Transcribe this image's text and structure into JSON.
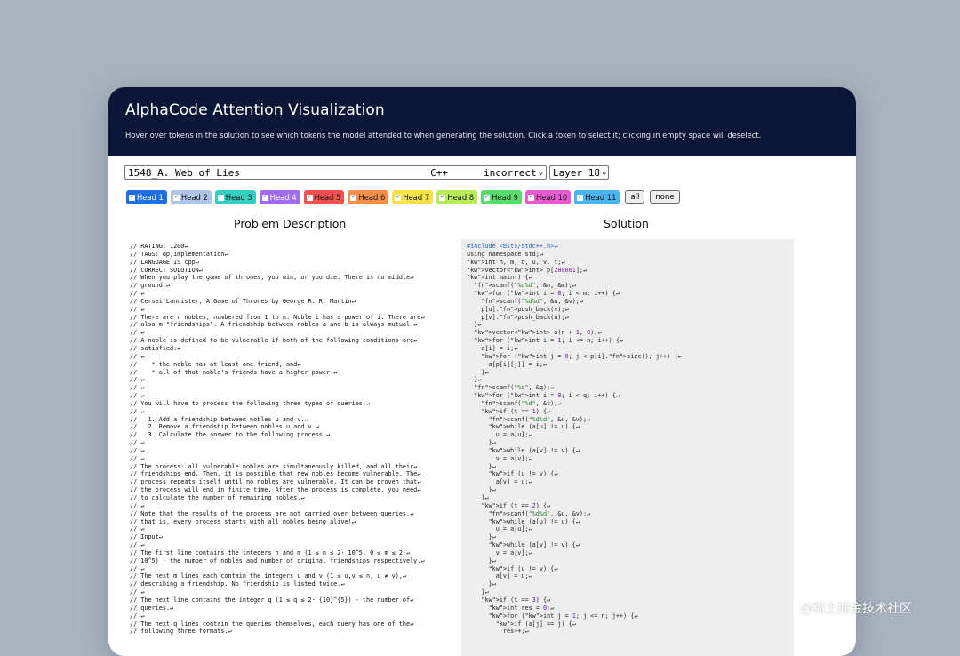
{
  "app": {
    "title": "AlphaCode Attention Visualization",
    "subtitle": "Hover over tokens in the solution to see which tokens the model attended to when generating the solution. Click a token to select it; clicking in empty space will deselect."
  },
  "selectors": {
    "problem_name": "1548_A. Web of Lies",
    "language": "C++",
    "correctness": "incorrect",
    "layer": "Layer 18"
  },
  "heads": [
    {
      "label": "Head 1",
      "color": "#1f6fe0"
    },
    {
      "label": "Head 2",
      "color": "#b0c4e8"
    },
    {
      "label": "Head 3",
      "color": "#34cfc0"
    },
    {
      "label": "Head 4",
      "color": "#a06cf0"
    },
    {
      "label": "Head 5",
      "color": "#f0504e"
    },
    {
      "label": "Head 6",
      "color": "#f7904a"
    },
    {
      "label": "Head 7",
      "color": "#f7e04a"
    },
    {
      "label": "Head 8",
      "color": "#b8ea5a"
    },
    {
      "label": "Head 9",
      "color": "#5adc6a"
    },
    {
      "label": "Head 10",
      "color": "#e85ad0"
    },
    {
      "label": "Head 11",
      "color": "#4ab4f0"
    }
  ],
  "buttons": {
    "all": "all",
    "none": "none"
  },
  "columns": {
    "problem": "Problem Description",
    "solution": "Solution"
  },
  "problem_lines": [
    "// RATING: 1200↵",
    "// TAGS: dp,implementation↵",
    "// LANGUAGE IS cpp↵",
    "// CORRECT SOLUTION↵",
    "// When you play the game of thrones, you win, or you die. There is no middle↵",
    "// ground.↵",
    "// ↵",
    "// Cersei Lannister, A Game of Thrones by George R. R. Martin↵",
    "// ↵",
    "// There are n nobles, numbered from 1 to n. Noble i has a power of i. There are↵",
    "// also m \"friendships\". A friendship between nobles a and b is always mutual.↵",
    "// ↵",
    "// A noble is defined to be vulnerable if both of the following conditions are↵",
    "// satisfied:↵",
    "// ↵",
    "//    * the noble has at least one friend, and↵",
    "//    * all of that noble's friends have a higher power.↵",
    "// ↵",
    "// ↵",
    "// ↵",
    "// You will have to process the following three types of queries.↵",
    "// ↵",
    "//   1. Add a friendship between nobles u and v.↵",
    "//   2. Remove a friendship between nobles u and v.↵",
    "//   3. Calculate the answer to the following process.↵",
    "// ↵",
    "// ↵",
    "// ↵",
    "// The process: all vulnerable nobles are simultaneously killed, and all their↵",
    "// friendships end. Then, it is possible that new nobles become vulnerable. The↵",
    "// process repeats itself until no nobles are vulnerable. It can be proven that↵",
    "// the process will end in finite time. After the process is complete, you need↵",
    "// to calculate the number of remaining nobles.↵",
    "// ↵",
    "// Note that the results of the process are not carried over between queries,↵",
    "// that is, every process starts with all nobles being alive!↵",
    "// ↵",
    "// Input↵",
    "// ↵",
    "// The first line contains the integers n and m (1 ≤ n ≤ 2· 10^5, 0 ≤ m ≤ 2·↵",
    "// 10^5) - the number of nobles and number of original friendships respectively.↵",
    "// ↵",
    "// The next m lines each contain the integers u and v (1 ≤ u,v ≤ n, u ≠ v),↵",
    "// describing a friendship. No friendship is listed twice.↵",
    "// ↵",
    "// The next line contains the integer q (1 ≤ q ≤ 2· {10}^{5}) - the number of↵",
    "// queries.↵",
    "// ↵",
    "// The next q lines contain the queries themselves, each query has one of the↵",
    "// following three formats.↵"
  ],
  "solution_lines": [
    "#include <bits/stdc++.h>↵",
    "using namespace std;↵",
    "int n, m, q, u, v, t;↵",
    "vector<int> p[200001];↵",
    "int main() {↵",
    "  scanf(\"%d%d\", &n, &m);↵",
    "  for (int i = 0; i < m; i++) {↵",
    "    scanf(\"%d%d\", &u, &v);↵",
    "    p[u].push_back(v);↵",
    "    p[v].push_back(u);↵",
    "  }↵",
    "  vector<int> a(n + 1, 0);↵",
    "  for (int i = 1; i <= n; i++) {↵",
    "    a[i] = i;↵",
    "    for (int j = 0; j < p[i].size(); j++) {↵",
    "      a[p[i][j]] = i;↵",
    "    }↵",
    "  }↵",
    "  scanf(\"%d\", &q);↵",
    "  for (int i = 0; i < q; i++) {↵",
    "    scanf(\"%d\", &t);↵",
    "    if (t == 1) {↵",
    "      scanf(\"%d%d\", &u, &v);↵",
    "      while (a[u] != u) {↵",
    "        u = a[u];↵",
    "      }↵",
    "      while (a[v] != v) {↵",
    "        v = a[v];↵",
    "      }↵",
    "      if (u != v) {↵",
    "        a[v] = u;↵",
    "      }↵",
    "    }↵",
    "    if (t == 2) {↵",
    "      scanf(\"%d%d\", &u, &v);↵",
    "      while (a[u] != u) {↵",
    "        u = a[u];↵",
    "      }↵",
    "      while (a[v] != v) {↵",
    "        v = a[v];↵",
    "      }↵",
    "      if (u != v) {↵",
    "        a[v] = u;↵",
    "      }↵",
    "    }↵",
    "    if (t == 3) {↵",
    "      int res = 0;↵",
    "      for (int j = 1; j <= n; j++) {↵",
    "        if (a[j] == j) {↵",
    "          res++;↵"
  ],
  "watermark": "@稀土掘金技术社区"
}
